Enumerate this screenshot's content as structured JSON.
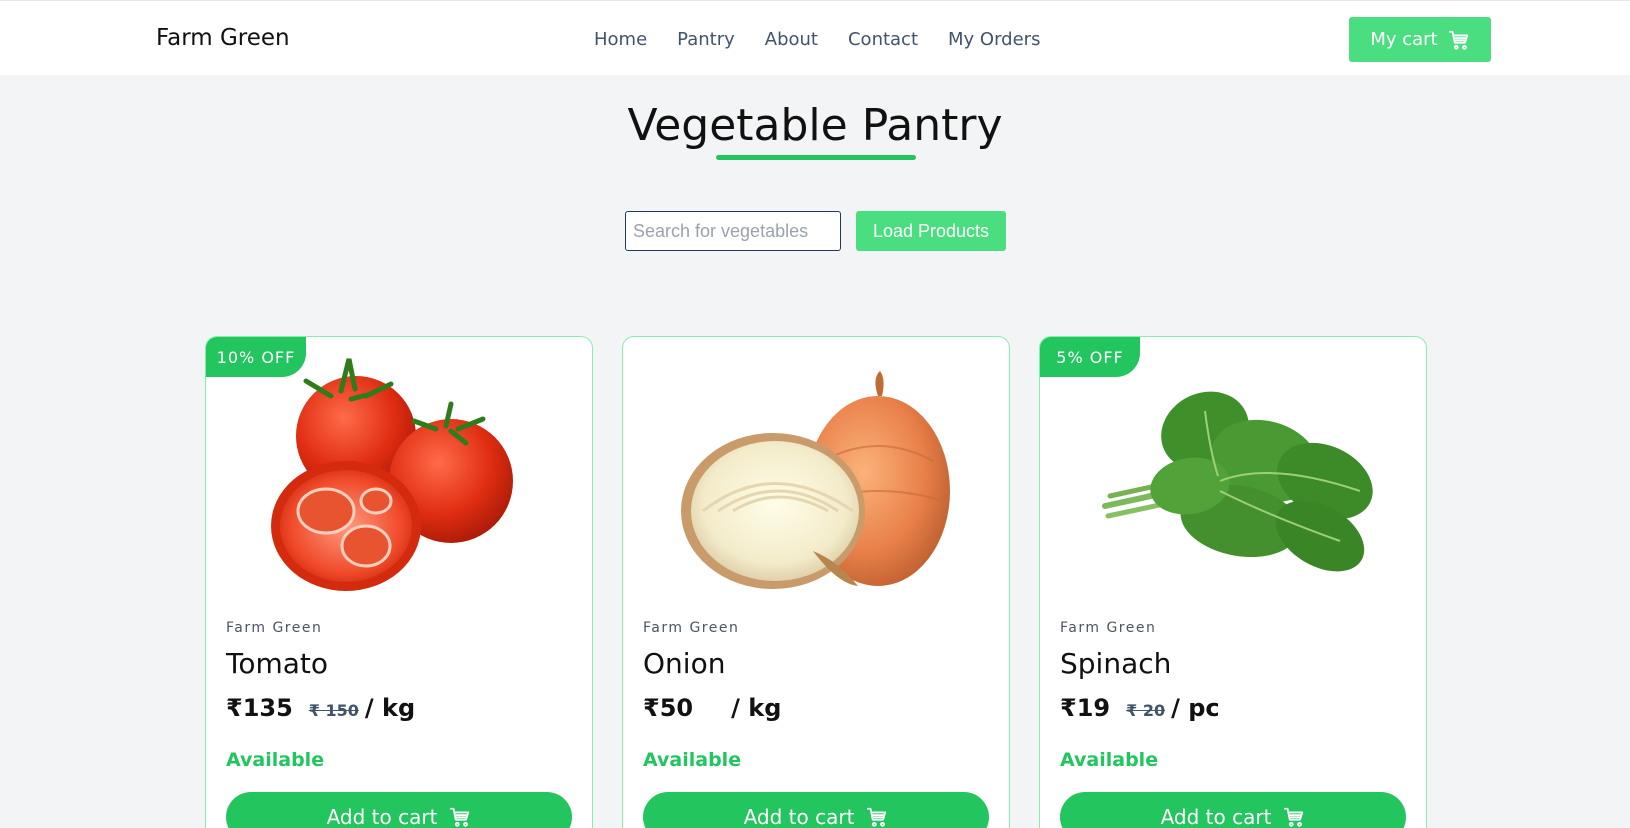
{
  "nav": {
    "brand": "Farm Green",
    "links": [
      "Home",
      "Pantry",
      "About",
      "Contact",
      "My Orders"
    ],
    "cart_label": "My cart"
  },
  "page": {
    "title": "Vegetable Pantry"
  },
  "search": {
    "placeholder": "Search for vegetables",
    "value": "",
    "load_label": "Load Products"
  },
  "products": [
    {
      "discount": "10% OFF",
      "vendor": "Farm Green",
      "name": "Tomato",
      "price": "₹135",
      "old_price": "₹ 150",
      "unit": "/ kg",
      "status": "Available",
      "button": "Add to cart",
      "image": "tomato-image"
    },
    {
      "discount": "",
      "vendor": "Farm Green",
      "name": "Onion",
      "price": "₹50",
      "old_price": "",
      "unit": "/ kg",
      "status": "Available",
      "button": "Add to cart",
      "image": "onion-image"
    },
    {
      "discount": "5% OFF",
      "vendor": "Farm Green",
      "name": "Spinach",
      "price": "₹19",
      "old_price": "₹ 20",
      "unit": "/ pc",
      "status": "Available",
      "button": "Add to cart",
      "image": "spinach-image"
    }
  ],
  "colors": {
    "accent": "#22c55e",
    "accent_light": "#4ade80",
    "background": "#f2f4f6",
    "nav_text": "#41546a"
  }
}
